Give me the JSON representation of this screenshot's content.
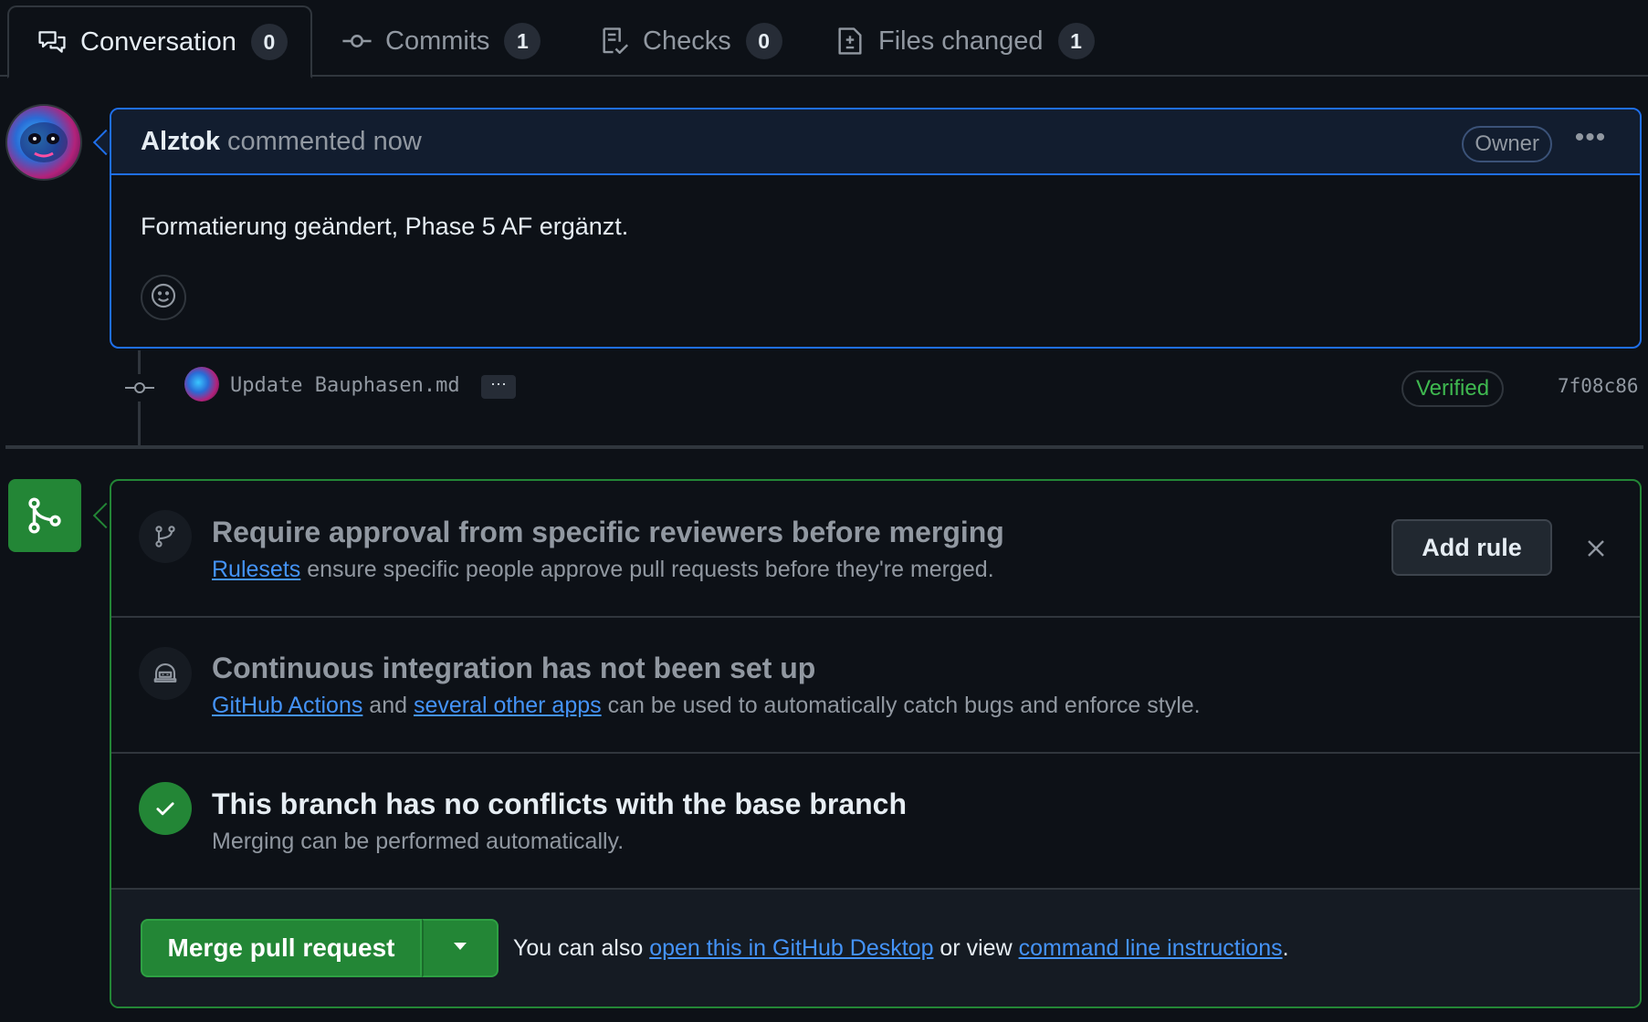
{
  "tabs": [
    {
      "label": "Conversation",
      "count": "0",
      "icon": "conversation-icon"
    },
    {
      "label": "Commits",
      "count": "1",
      "icon": "commit-icon"
    },
    {
      "label": "Checks",
      "count": "0",
      "icon": "checklist-icon"
    },
    {
      "label": "Files changed",
      "count": "1",
      "icon": "file-diff-icon"
    }
  ],
  "comment": {
    "author": "Alztok",
    "meta": "commented now",
    "badge": "Owner",
    "more_label": "•••",
    "body": "Formatierung geändert, Phase 5 AF ergänzt."
  },
  "commit": {
    "message": "Update Bauphasen.md",
    "expand_label": "···",
    "verified": "Verified",
    "sha": "7f08c86"
  },
  "merge": {
    "rule_title": "Require approval from specific reviewers before merging",
    "rule_link": "Rulesets",
    "rule_desc": " ensure specific people approve pull requests before they're merged.",
    "add_rule": "Add rule",
    "ci_title": "Continuous integration has not been set up",
    "ci_link1": "GitHub Actions",
    "ci_and": " and ",
    "ci_link2": "several other apps",
    "ci_desc": " can be used to automatically catch bugs and enforce style.",
    "conflict_title": "This branch has no conflicts with the base branch",
    "conflict_desc": "Merging can be performed automatically.",
    "merge_button": "Merge pull request",
    "footer_pre": "You can also ",
    "footer_link1": "open this in GitHub Desktop",
    "footer_mid": " or view ",
    "footer_link2": "command line instructions",
    "footer_end": "."
  },
  "colors": {
    "background": "#0d1117",
    "accent_blue": "#1f6feb",
    "link": "#4493f8",
    "success": "#238636",
    "muted": "#9198a1"
  }
}
